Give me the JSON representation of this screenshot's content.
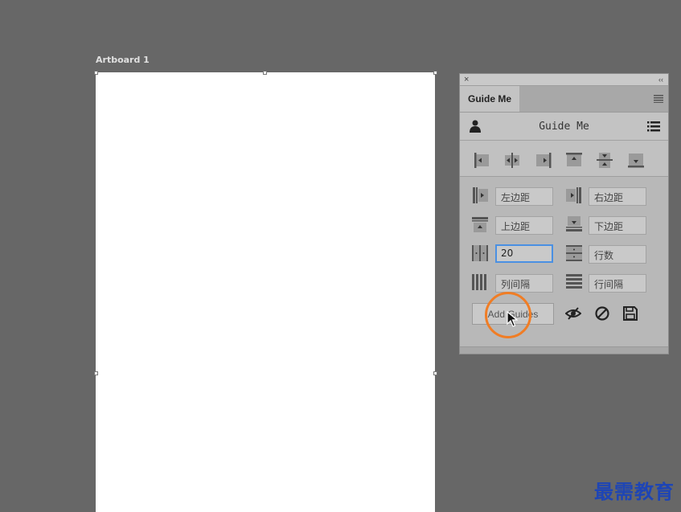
{
  "artboard": {
    "label": "Artboard 1"
  },
  "panel": {
    "close_glyph": "×",
    "collapse_glyph": "‹‹",
    "tab_label": "Guide Me",
    "tab_menu_icon": "menu-icon",
    "header_title": "Guide Me",
    "header_left_icon": "user-icon",
    "header_right_icon": "list-icon",
    "align_icons": [
      "align-left-icon",
      "align-center-h-icon",
      "align-right-icon",
      "align-top-icon",
      "align-center-v-icon",
      "align-bottom-icon"
    ],
    "fields": {
      "left_margin": {
        "placeholder": "左边距",
        "value": ""
      },
      "right_margin": {
        "placeholder": "右边距",
        "value": ""
      },
      "top_margin": {
        "placeholder": "上边距",
        "value": ""
      },
      "bottom_margin": {
        "placeholder": "下边距",
        "value": ""
      },
      "columns": {
        "placeholder": "",
        "value": "20"
      },
      "rows": {
        "placeholder": "行数",
        "value": ""
      },
      "column_gutter": {
        "placeholder": "列间隔",
        "value": ""
      },
      "row_gutter": {
        "placeholder": "行间隔",
        "value": ""
      }
    },
    "add_guides_label": "Add Guides",
    "tool_icons": [
      "eye-slash-icon",
      "clear-icon",
      "save-icon"
    ]
  },
  "watermark": "最需教育",
  "colors": {
    "background": "#676767",
    "panel": "#b8b8b8",
    "focus": "#4a90e2",
    "ring": "#f07d25",
    "watermark": "#1e45b5"
  }
}
